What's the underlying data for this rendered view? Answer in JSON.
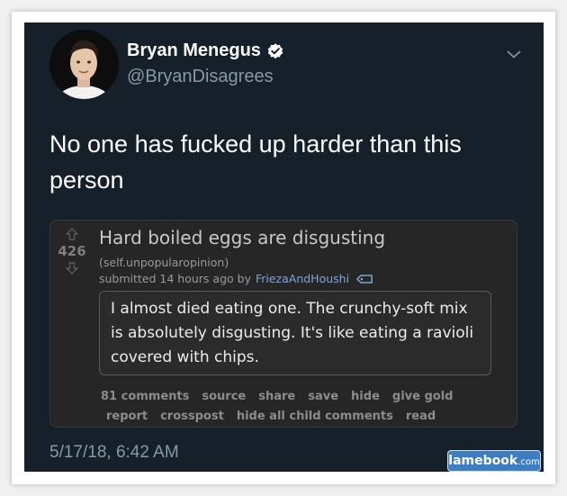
{
  "tweet": {
    "display_name": "Bryan Menegus",
    "handle": "@BryanDisagrees",
    "verified": true,
    "text": "No one has fucked up harder than this person",
    "timestamp": "5/17/18, 6:42 AM",
    "icons": {
      "verified": "verified-badge-icon",
      "menu": "chevron-down-icon"
    }
  },
  "reddit_post": {
    "score": "426",
    "title": "Hard boiled eggs are disgusting",
    "subreddit": "(self.unpopularopinion)",
    "submitted_prefix": "submitted 14 hours ago by",
    "author": "FriezaAndHoushi",
    "selftext": "I almost died eating one. The crunchy-soft mix is absolutely disgusting. It's like eating a ravioli covered with chips.",
    "actions_row1": [
      "81 comments",
      "source",
      "share",
      "save",
      "hide",
      "give gold"
    ],
    "actions_row2": [
      "report",
      "crosspost",
      "hide all child comments",
      "read"
    ]
  },
  "watermark": {
    "brand": "lamebook",
    "suffix": ".com"
  },
  "colors": {
    "tweet_bg": "#15202b",
    "reddit_bg": "#262626",
    "link": "#7ea6d6",
    "verified": "#ffffff"
  }
}
